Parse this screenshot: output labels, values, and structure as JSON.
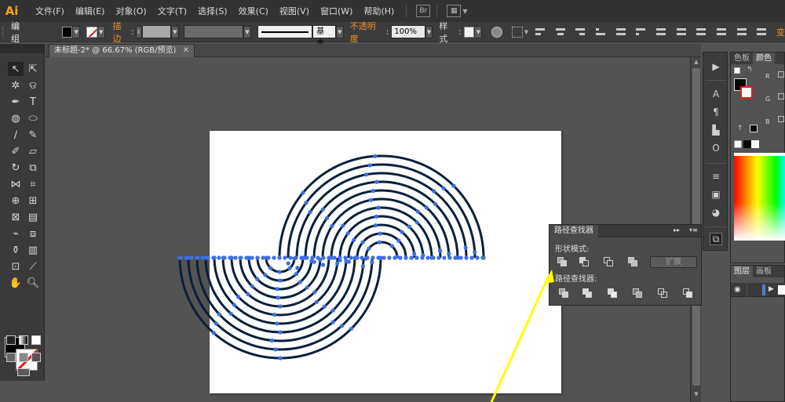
{
  "app": {
    "logo": "Ai"
  },
  "menu": [
    {
      "id": "file",
      "label": "文件(F)"
    },
    {
      "id": "edit",
      "label": "编辑(E)"
    },
    {
      "id": "object",
      "label": "对象(O)"
    },
    {
      "id": "type",
      "label": "文字(T)"
    },
    {
      "id": "select",
      "label": "选择(S)"
    },
    {
      "id": "effect",
      "label": "效果(C)"
    },
    {
      "id": "view",
      "label": "视图(V)"
    },
    {
      "id": "window",
      "label": "窗口(W)"
    },
    {
      "id": "help",
      "label": "帮助(H)"
    }
  ],
  "control": {
    "selection": "编组",
    "stroke_label": "描边",
    "stroke_profile": "基本",
    "opacity_label": "不透明度",
    "opacity_value": "100%",
    "style_label": "样式",
    "style_colon": ":",
    "truncated_right": "变"
  },
  "document": {
    "tab": "未标题-2* @ 66.67% (RGB/预览)",
    "close": "✕"
  },
  "color_panel": {
    "tabs": [
      "色板",
      "颜色"
    ],
    "channels": [
      "R",
      "G",
      "B"
    ]
  },
  "layers_panel": {
    "tabs": [
      "图层",
      "画板"
    ]
  },
  "pathfinder": {
    "title": "路径查找器",
    "shape_modes_label": "形状模式:",
    "pathfinders_label": "路径查找器:",
    "expand_label": "扩展"
  },
  "colors": {
    "stroke": "#0b1f3a",
    "anchor": "#3c6fe6",
    "arrow": "#ffff00",
    "logo": "#f7a21b"
  }
}
